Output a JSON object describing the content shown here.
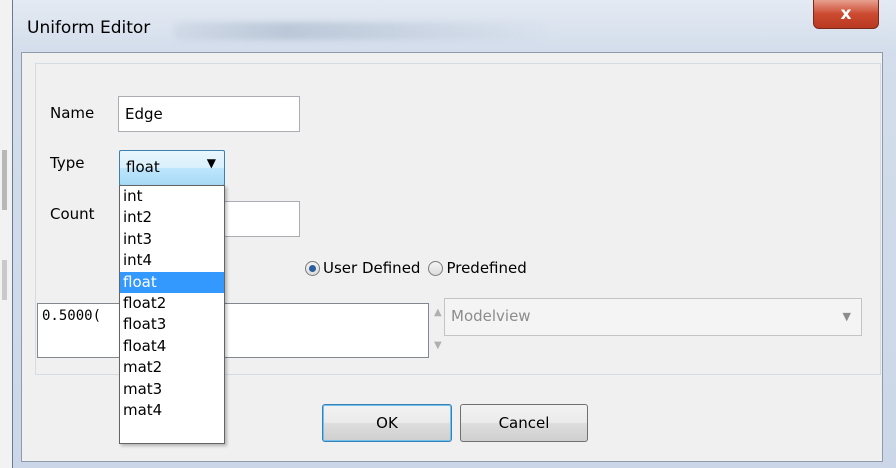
{
  "window": {
    "title": "Uniform Editor",
    "close_glyph": "x"
  },
  "form": {
    "name_label": "Name",
    "name_value": "Edge",
    "type_label": "Type",
    "type_selected": "float",
    "type_arrow": "▼",
    "count_label": "Count",
    "count_value": ""
  },
  "type_dropdown": {
    "options": [
      "int",
      "int2",
      "int3",
      "int4",
      "float",
      "float2",
      "float3",
      "float4",
      "mat2",
      "mat3",
      "mat4"
    ],
    "highlighted_index": 4
  },
  "mode": {
    "user_defined_label": "User Defined",
    "predefined_label": "Predefined",
    "selected": "User Defined"
  },
  "value_editor": {
    "text": "0.5000("
  },
  "predefined_select": {
    "value": "Modelview",
    "arrow": "▼",
    "enabled": false
  },
  "buttons": {
    "ok_label": "OK",
    "cancel_label": "Cancel"
  },
  "colors": {
    "highlight": "#3399ff",
    "close_button": "#cc4a30"
  }
}
